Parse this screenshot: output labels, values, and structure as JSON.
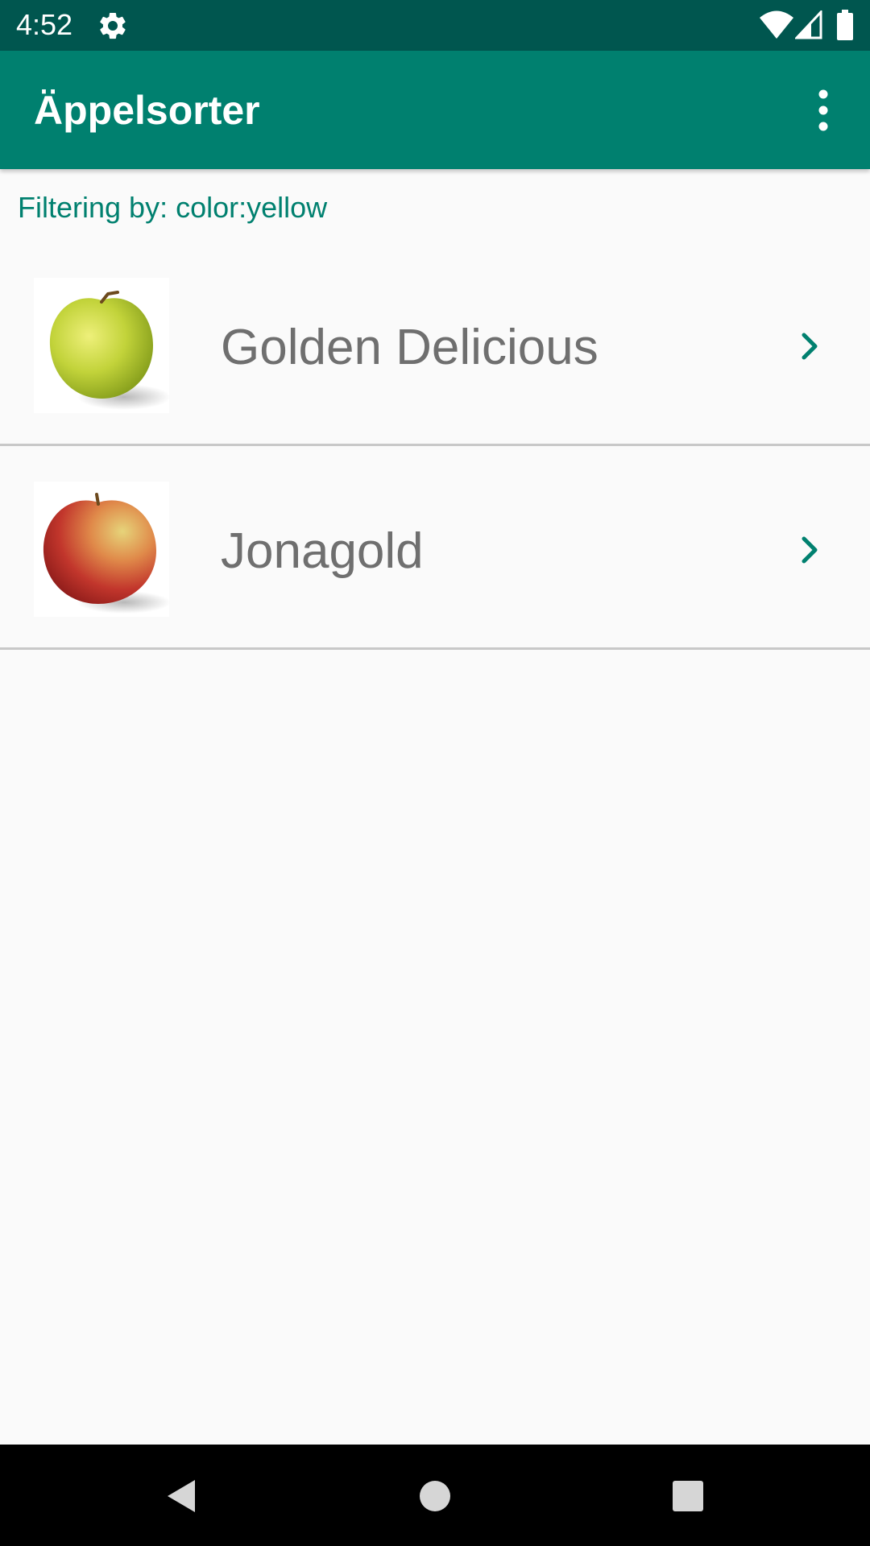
{
  "status_bar": {
    "time": "4:52",
    "icons": [
      "gear-icon",
      "wifi-icon",
      "signal-icon",
      "battery-icon"
    ],
    "background": "#00564f"
  },
  "app_bar": {
    "title": "Äppelsorter",
    "menu_icon": "more-vert-icon",
    "background": "#00806f"
  },
  "filter": {
    "text": "Filtering by: color:yellow",
    "color": "#00806f"
  },
  "list": {
    "items": [
      {
        "label": "Golden Delicious",
        "image": "yellow-green-apple-image",
        "icon": "chevron-right-icon"
      },
      {
        "label": "Jonagold",
        "image": "red-yellow-apple-image",
        "icon": "chevron-right-icon"
      }
    ]
  },
  "nav_bar": {
    "icons": [
      "back-icon",
      "home-icon",
      "recents-icon"
    ]
  }
}
